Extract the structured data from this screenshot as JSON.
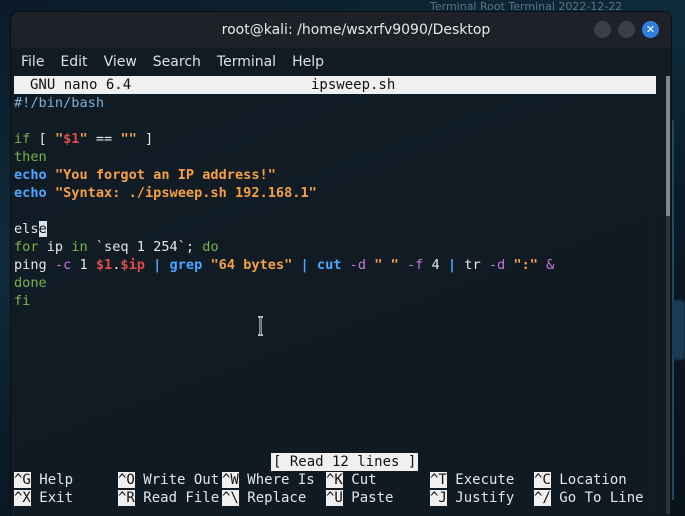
{
  "window": {
    "title": "root@kali: /home/wsxrfv9090/Desktop",
    "close_glyph": "✕"
  },
  "menubar": {
    "items": [
      "File",
      "Edit",
      "View",
      "Search",
      "Terminal",
      "Help"
    ]
  },
  "desktop": {
    "top_text": "Terminal    Root Terminal    2022-12-22"
  },
  "nano": {
    "version": "GNU nano 6.4",
    "filename": "ipsweep.sh",
    "status": "[ Read 12 lines ]",
    "lines": [
      "#!/bin/bash",
      "",
      "if [ \"$1\" == \"\" ]",
      "then",
      "echo \"You forgot an IP address!\"",
      "echo \"Syntax: ./ipsweep.sh 192.168.1\"",
      "",
      "else",
      "for ip in `seq 1 254`; do",
      "ping -c 1 $1.$ip | grep \"64 bytes\" | cut -d \" \" -f 4 | tr -d \":\" &",
      "done",
      "fi"
    ],
    "shortcuts": [
      {
        "key": "^G",
        "label": "Help"
      },
      {
        "key": "^O",
        "label": "Write Out"
      },
      {
        "key": "^W",
        "label": "Where Is"
      },
      {
        "key": "^K",
        "label": "Cut"
      },
      {
        "key": "^T",
        "label": "Execute"
      },
      {
        "key": "^C",
        "label": "Location"
      },
      {
        "key": "^X",
        "label": "Exit"
      },
      {
        "key": "^R",
        "label": "Read File"
      },
      {
        "key": "^\\",
        "label": "Replace"
      },
      {
        "key": "^U",
        "label": "Paste"
      },
      {
        "key": "^J",
        "label": "Justify"
      },
      {
        "key": "^/",
        "label": "Go To Line"
      }
    ]
  },
  "colors": {
    "titlebar": "#1e2228",
    "accent_close": "#2f7fe0",
    "string": "#f6a042",
    "keyword": "#4da6ff",
    "variable": "#e04b4b",
    "option": "#c678dd"
  }
}
